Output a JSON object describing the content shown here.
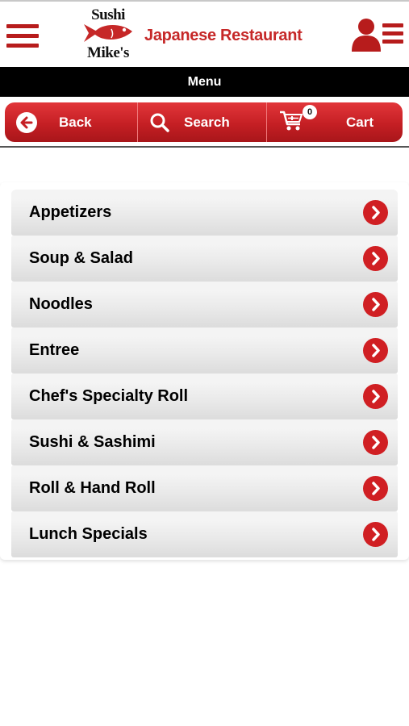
{
  "header": {
    "logo_top": "Sushi",
    "logo_bottom": "Mike's",
    "title": "Japanese Restaurant"
  },
  "menu_bar": {
    "title": "Menu"
  },
  "toolbar": {
    "back_label": "Back",
    "search_label": "Search",
    "cart_label": "Cart",
    "cart_count": "0"
  },
  "menu": {
    "items": [
      {
        "label": "Appetizers"
      },
      {
        "label": "Soup & Salad"
      },
      {
        "label": "Noodles"
      },
      {
        "label": "Entree"
      },
      {
        "label": "Chef's Specialty Roll"
      },
      {
        "label": "Sushi & Sashimi"
      },
      {
        "label": "Roll & Hand Roll"
      },
      {
        "label": "Lunch Specials"
      }
    ]
  },
  "icons": {
    "hamburger": "hamburger-menu-icon",
    "user_menu": "user-list-icon",
    "back": "arrow-left-circle-icon",
    "search": "search-icon",
    "cart": "cart-add-icon",
    "chevron": "chevron-right-circle-icon"
  },
  "colors": {
    "brand_red": "#c62828",
    "toolbar_red": "#c51f24",
    "menu_bar": "#000000"
  }
}
